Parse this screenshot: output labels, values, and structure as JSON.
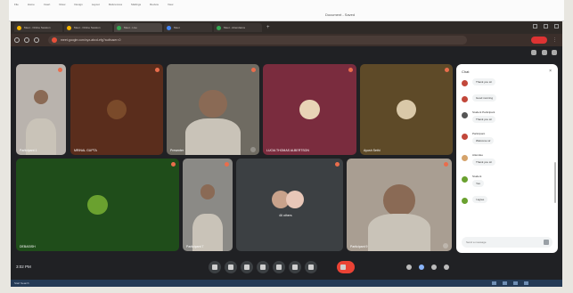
{
  "doc": {
    "menu": [
      "File",
      "Home",
      "Insert",
      "Draw",
      "Design",
      "Layout",
      "References",
      "Mailings",
      "Review",
      "View"
    ],
    "title": "Document - Saved"
  },
  "browser": {
    "tabs": [
      {
        "label": "Meet - Online Session",
        "color": "#f4b400"
      },
      {
        "label": "Meet - Online Session",
        "color": "#f4b400"
      },
      {
        "label": "Meet - Live",
        "color": "#34a853"
      },
      {
        "label": "Meet",
        "color": "#4285f4"
      },
      {
        "label": "Meet - Attendance",
        "color": "#34a853"
      }
    ],
    "url": "meet.google.com/xyz-abcd-efg?authuser=0"
  },
  "tiles": [
    {
      "name": "Participant 1",
      "bg": "#b9b3ad",
      "kind": "video"
    },
    {
      "name": "MRINAL GUPTA",
      "bg": "#5a2d1c",
      "kind": "avatar",
      "avatar": "#7a4a2a"
    },
    {
      "name": "Presenter",
      "bg": "#6f6b62",
      "kind": "video"
    },
    {
      "name": "LUCIA THOMAS ALBERTSON",
      "bg": "#7a2c3e",
      "kind": "avatar",
      "avatar": "#e8d4b6"
    },
    {
      "name": "Ayush Sethi",
      "bg": "#5e4a28",
      "kind": "avatar",
      "avatar": "#d9c8a8"
    },
    {
      "name": "DEBASISH",
      "bg": "#1f4d1a",
      "kind": "avatar",
      "avatar": "#6aa12f"
    },
    {
      "name": "Participant 7",
      "bg": "#8b8a86",
      "kind": "video"
    },
    {
      "name": "46 others",
      "bg": "#3c4043",
      "kind": "group"
    },
    {
      "name": "Participant 9",
      "bg": "#a99e92",
      "kind": "video"
    }
  ],
  "controls": {
    "time": "3:02 PM",
    "meeting_code": "xyz",
    "buttons": [
      "mic",
      "camera",
      "captions",
      "emoji",
      "present",
      "raise-hand",
      "more"
    ],
    "end": "leave-call"
  },
  "chat": {
    "title": "Chat",
    "input_placeholder": "Send a message",
    "messages": [
      {
        "sender": "",
        "text": "Thank you sir",
        "avatar": "#c2473a"
      },
      {
        "sender": "",
        "text": "Good morning",
        "avatar": "#c2473a"
      },
      {
        "sender": "Student Participant",
        "text": "Thank you sir",
        "avatar": "#555555"
      },
      {
        "sender": "Participant",
        "text": "Welcome sir",
        "avatar": "#c2473a"
      },
      {
        "sender": "Attendee",
        "text": "Thank you sir",
        "avatar": "#d5a36b"
      },
      {
        "sender": "Student",
        "text": "Yes",
        "avatar": "#6aa12f"
      },
      {
        "sender": "",
        "text": "I agree",
        "avatar": "#6aa12f"
      }
    ]
  },
  "taskbar": {
    "text": "Start  Search"
  },
  "colors": {
    "meet_bg": "#202124",
    "end_call": "#ea4335",
    "accent": "#8ab4f8"
  }
}
